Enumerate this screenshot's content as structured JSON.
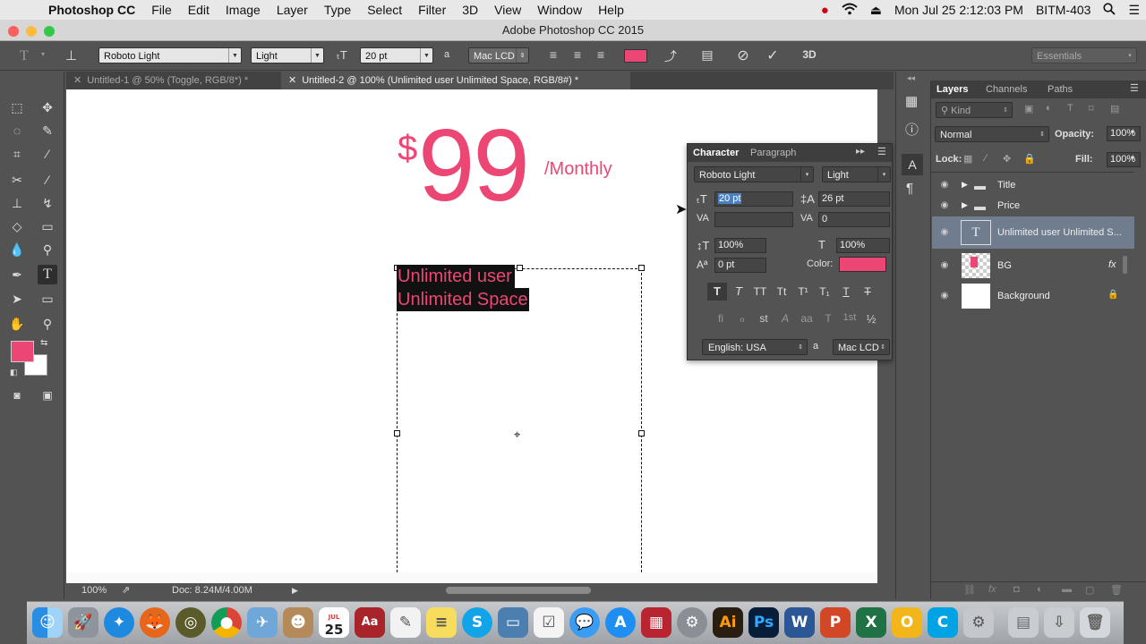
{
  "menubar": {
    "app_name": "Photoshop CC",
    "items": [
      "File",
      "Edit",
      "Image",
      "Layer",
      "Type",
      "Select",
      "Filter",
      "3D",
      "View",
      "Window",
      "Help"
    ],
    "datetime": "Mon Jul 25  2:12:03 PM",
    "user": "BITM-403"
  },
  "window": {
    "title": "Adobe Photoshop CC 2015"
  },
  "options_bar": {
    "font_family": "Roboto Light",
    "font_style": "Light",
    "font_size": "20 pt",
    "aa_icon_label": "a",
    "antialias": "Mac LCD",
    "text_color": "#ec4774",
    "workspace": "Essentials"
  },
  "doc_tabs": [
    {
      "label": "Untitled-1 @ 50% (Toggle, RGB/8*) *",
      "active": false
    },
    {
      "label": "Untitled-2 @ 100% (Unlimited user Unlimited Space, RGB/8#) *",
      "active": true
    }
  ],
  "canvas": {
    "price_currency": "$",
    "price_value": "99",
    "price_period": "/Monthly",
    "text_line1": "Unlimited user",
    "text_line2": "Unlimited Space",
    "accent_color": "#ec4774"
  },
  "statusbar": {
    "zoom": "100%",
    "doc_size": "Doc: 8.24M/4.00M"
  },
  "character_panel": {
    "tabs": [
      "Character",
      "Paragraph"
    ],
    "font_family": "Roboto Light",
    "font_style": "Light",
    "font_size": "20 pt",
    "leading": "26 pt",
    "kerning": "",
    "tracking": "0",
    "vertical_scale": "100%",
    "horizontal_scale": "100%",
    "baseline_shift": "0 pt",
    "color_label": "Color:",
    "color": "#ec4774",
    "language": "English: USA",
    "antialias_icon_label": "a",
    "antialias": "Mac LCD",
    "type_buttons": [
      "T",
      "T",
      "TT",
      "Tt",
      "T¹",
      "T₁",
      "T",
      "T"
    ],
    "ot_buttons": [
      "fi",
      "ℴ",
      "st",
      "A",
      "aa",
      "T",
      "1st",
      "½"
    ]
  },
  "layers_panel": {
    "tabs": [
      "Layers",
      "Channels",
      "Paths"
    ],
    "filter": "Kind",
    "blend_mode": "Normal",
    "opacity_label": "Opacity:",
    "opacity": "100%",
    "lock_label": "Lock:",
    "fill_label": "Fill:",
    "fill": "100%",
    "layers": [
      {
        "name": "Title",
        "type": "group"
      },
      {
        "name": "Price",
        "type": "group"
      },
      {
        "name": "Unlimited user Unlimited S...",
        "type": "text",
        "selected": true
      },
      {
        "name": "BG",
        "type": "smart",
        "fx": "fx"
      },
      {
        "name": "Background",
        "type": "background",
        "locked": true
      }
    ]
  },
  "dock": {
    "calendar_month": "JUL",
    "calendar_day": "25",
    "apps": [
      "Finder",
      "Launchpad",
      "Safari",
      "Firefox",
      "Network Radar",
      "Chrome",
      "Preview",
      "Contacts",
      "Calendar",
      "Dictionary",
      "TextEdit",
      "Notes",
      "Skype",
      "Screen",
      "Reminders",
      "Messages",
      "App Store",
      "Photo Booth",
      "System Preferences",
      "Illustrator",
      "Photoshop",
      "Word",
      "PowerPoint",
      "Excel",
      "Outlook",
      "Skype for Business",
      "Utilities",
      "Folder",
      "Downloads",
      "Trash"
    ]
  }
}
